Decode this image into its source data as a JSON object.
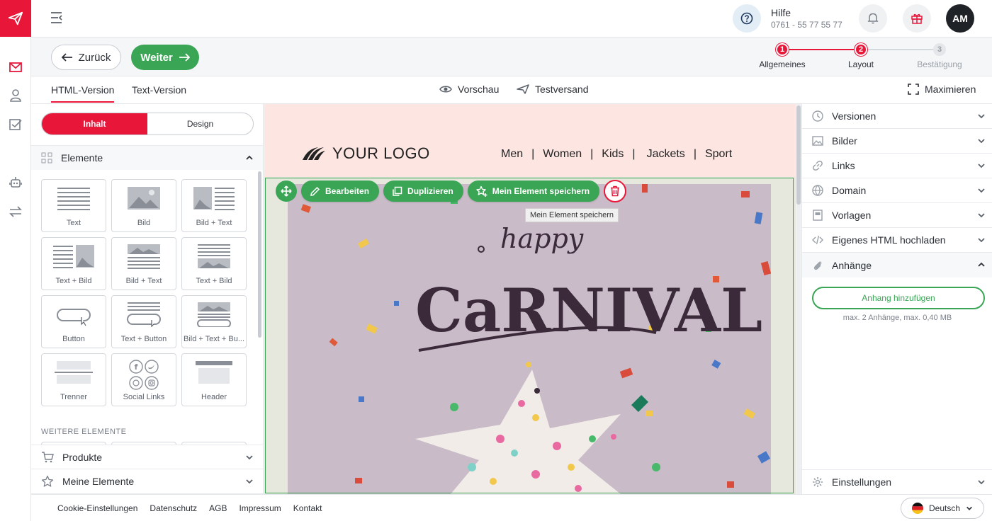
{
  "topbar": {
    "help_title": "Hilfe",
    "help_phone": "0761 - 55 77 55 77",
    "avatar_initials": "AM"
  },
  "stepbar": {
    "back_label": "Zurück",
    "next_label": "Weiter",
    "steps": [
      {
        "num": "1",
        "label": "Allgemeines",
        "state": "done"
      },
      {
        "num": "2",
        "label": "Layout",
        "state": "active"
      },
      {
        "num": "3",
        "label": "Bestätigung",
        "state": "pending"
      }
    ]
  },
  "tabs": {
    "html": "HTML-Version",
    "text": "Text-Version",
    "preview": "Vorschau",
    "testsend": "Testversand",
    "maximize": "Maximieren"
  },
  "leftpanel": {
    "seg_content": "Inhalt",
    "seg_design": "Design",
    "elements_header": "Elemente",
    "tiles": [
      "Text",
      "Bild",
      "Bild + Text",
      "Text + Bild",
      "Bild + Text",
      "Text + Bild",
      "Button",
      "Text + Button",
      "Bild + Text + Bu...",
      "Trenner",
      "Social Links",
      "Header"
    ],
    "weitere": "WEITERE ELEMENTE",
    "products": "Produkte",
    "my_elements": "Meine Elemente"
  },
  "canvas": {
    "logo_text": "YOUR LOGO",
    "nav": [
      "Men",
      "Women",
      "Kids",
      "Jackets",
      "Sport"
    ],
    "hero_text_happy": "happy",
    "hero_text_main": "CaRNIVAL",
    "actions": {
      "edit": "Bearbeiten",
      "duplicate": "Duplizieren",
      "save": "Mein Element speichern"
    },
    "tooltip": "Mein Element speichern"
  },
  "rightpanel": {
    "items": [
      "Versionen",
      "Bilder",
      "Links",
      "Domain",
      "Vorlagen",
      "Eigenes HTML hochladen",
      "Anhänge"
    ],
    "attach_button": "Anhang hinzufügen",
    "attach_note": "max. 2 Anhänge, max. 0,40 MB",
    "settings": "Einstellungen"
  },
  "footer": {
    "links": [
      "Cookie-Einstellungen",
      "Datenschutz",
      "AGB",
      "Impressum",
      "Kontakt"
    ],
    "language": "Deutsch"
  },
  "colors": {
    "brand_red": "#e8173a",
    "accent_green": "#3aa655"
  }
}
